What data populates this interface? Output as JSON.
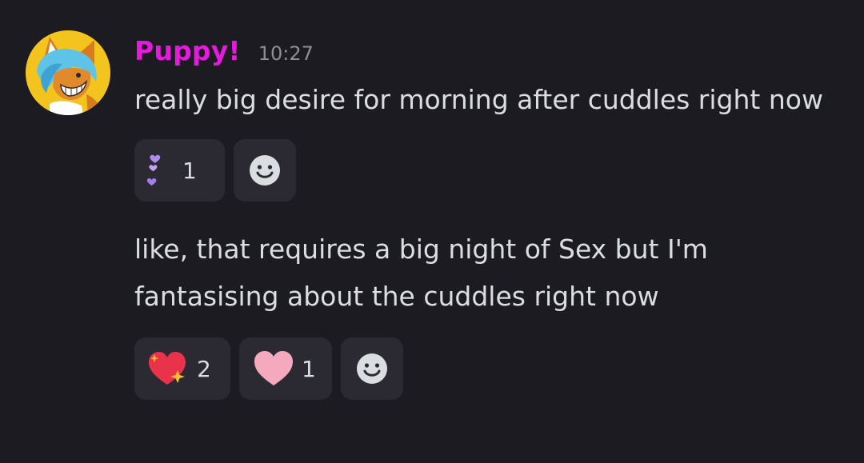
{
  "message_group": {
    "username": "Puppy!",
    "timestamp": "10:27",
    "avatar_icon": "fox-avatar-icon",
    "username_color": "#e51adc",
    "messages": [
      {
        "text": "really big desire for morning after cuddles right now",
        "reactions": [
          {
            "emoji": "purple-hearts-emoji",
            "count": "1"
          }
        ]
      },
      {
        "text": "like, that requires a big night of Sex but I'm fantasising about the cuddles right now",
        "reactions": [
          {
            "emoji": "sparkling-heart-emoji",
            "count": "2"
          },
          {
            "emoji": "pink-heart-emoji",
            "count": "1"
          }
        ]
      }
    ],
    "add_reaction_icon": "smiley-add-reaction-icon"
  }
}
